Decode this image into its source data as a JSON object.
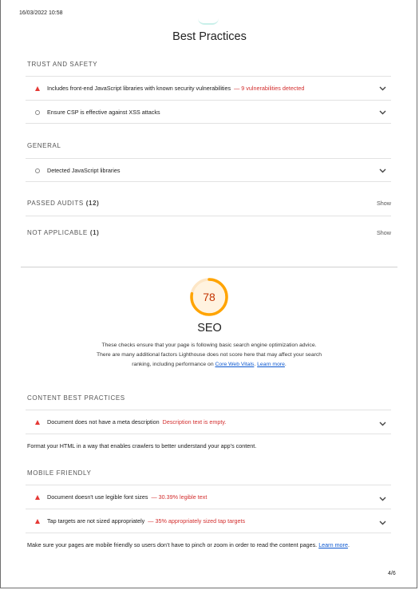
{
  "header": {
    "timestamp": "16/03/2022 10:58"
  },
  "best_practices": {
    "title": "Best Practices",
    "trust_and_safety": {
      "title": "TRUST AND SAFETY",
      "audits": [
        {
          "text": "Includes front-end JavaScript libraries with known security vulnerabilities",
          "warning": "— 9 vulnerabilities detected",
          "status": "fail"
        },
        {
          "text": "Ensure CSP is effective against XSS attacks",
          "warning": "",
          "status": "info"
        }
      ]
    },
    "general": {
      "title": "GENERAL",
      "audits": [
        {
          "text": "Detected JavaScript libraries",
          "warning": "",
          "status": "info"
        }
      ]
    },
    "passed_audits": {
      "label": "PASSED AUDITS",
      "count": "(12)",
      "action": "Show"
    },
    "not_applicable": {
      "label": "NOT APPLICABLE",
      "count": "(1)",
      "action": "Show"
    }
  },
  "seo": {
    "score": "78",
    "score_fraction": 0.78,
    "title": "SEO",
    "description": "These checks ensure that your page is following basic search engine optimization advice. There are many additional factors Lighthouse does not score here that may affect your search ranking, including performance on",
    "cwv_link": "Core Web Vitals",
    "learn_more": "Learn more",
    "content_best_practices": {
      "title": "CONTENT BEST PRACTICES",
      "audits": [
        {
          "text": "Document does not have a meta description",
          "warning": "Description text is empty.",
          "status": "fail"
        }
      ],
      "note": "Format your HTML in a way that enables crawlers to better understand your app’s content."
    },
    "mobile_friendly": {
      "title": "MOBILE FRIENDLY",
      "audits": [
        {
          "text": "Document doesn't use legible font sizes",
          "warning": "— 30.39% legible text",
          "status": "fail"
        },
        {
          "text": "Tap targets are not sized appropriately",
          "warning": "— 35% appropriately sized tap targets",
          "status": "fail"
        }
      ],
      "note": "Make sure your pages are mobile friendly so users don’t have to pinch or zoom in order to read the content pages.",
      "note_link": "Learn more"
    }
  },
  "colors": {
    "fail": "#e53935",
    "average": "#ffa400",
    "average_text": "#c33300",
    "link": "#0b57d0"
  },
  "footer": {
    "page_number": "4/6"
  }
}
